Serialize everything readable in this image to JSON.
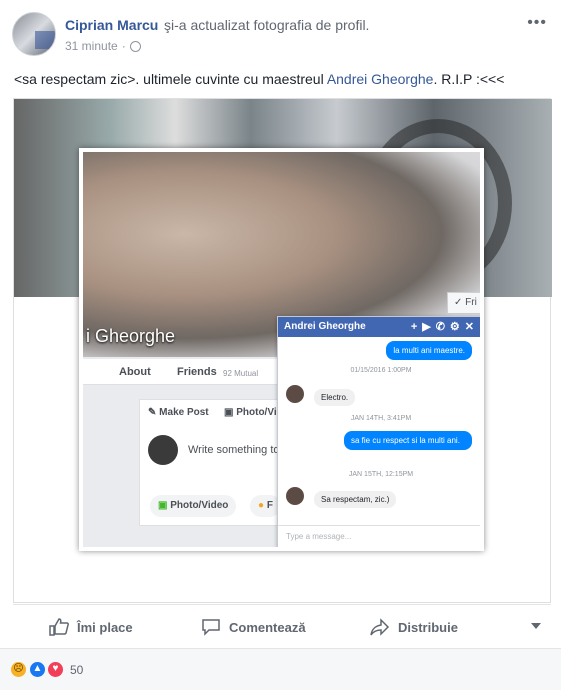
{
  "post": {
    "author": "Ciprian Marcu",
    "action": "şi-a actualizat fotografia de profil.",
    "time": "31 minute",
    "separator": "·",
    "more_icon": "ellipsis-icon",
    "caption_prefix": "<sa respectam zic>. ultimele cuvinte cu maestreul ",
    "caption_link": "Andrei Gheorghe",
    "caption_suffix": ". R.I.P :<<<"
  },
  "screenshot": {
    "cover_name": "i Gheorghe",
    "friend_chip": "✓ Fri",
    "nav": {
      "about": "About",
      "friends": "Friends",
      "mutual": "92 Mutual"
    },
    "composer": {
      "make_post": "Make Post",
      "photo_video_tab": "Photo/Vi",
      "placeholder": "Write something to",
      "photo_video_button": "Photo/Video",
      "feeling_button": "F"
    },
    "chat": {
      "title": "Andrei Gheorghe",
      "messages": [
        {
          "dir": "out",
          "text": "la multi ani maestre."
        },
        {
          "dir": "stamp",
          "text": "01/15/2016 1:00PM"
        },
        {
          "dir": "in",
          "text": "Electro."
        },
        {
          "dir": "stamp",
          "text": "JAN 14TH, 3:41PM"
        },
        {
          "dir": "out",
          "text": "sa fie cu respect si la multi ani."
        },
        {
          "dir": "stamp",
          "text": "JAN 15TH, 12:15PM"
        },
        {
          "dir": "in",
          "text": "Sa respectam, zic.)"
        }
      ],
      "input_placeholder": "Type a message..."
    }
  },
  "actions": {
    "like": "Îmi place",
    "comment": "Comentează",
    "share": "Distribuie"
  },
  "reactions": {
    "icons": [
      "sad-icon",
      "like-icon",
      "love-icon"
    ],
    "colors": {
      "sad": "#f7b125",
      "like": "#1877f2",
      "love": "#f33e58"
    },
    "count": "50"
  },
  "colors": {
    "link": "#365899",
    "chat_header": "#4267b2",
    "bubble": "#0084ff"
  }
}
